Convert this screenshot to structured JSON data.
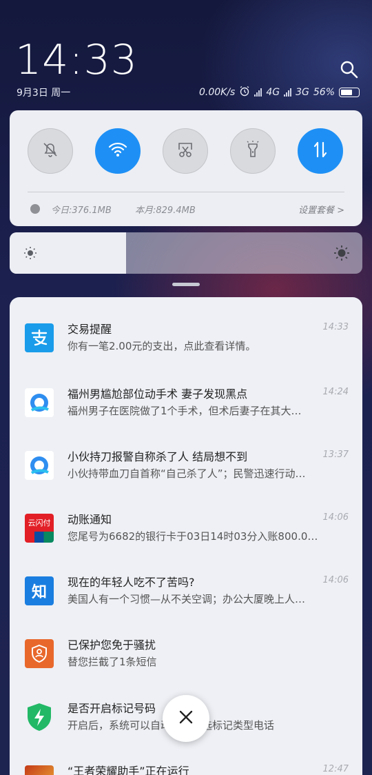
{
  "lockscreen": {
    "time": "14:33",
    "date": "9月3日 周一",
    "net_speed": "0.00K/s",
    "net1": "4G",
    "net2": "3G",
    "battery": "56%"
  },
  "quick_settings": {
    "toggles": [
      {
        "name": "mute",
        "icon": "bell-off-icon",
        "on": false
      },
      {
        "name": "wifi",
        "icon": "wifi-icon",
        "on": true
      },
      {
        "name": "screenshot",
        "icon": "scissors-screenshot-icon",
        "on": false
      },
      {
        "name": "flashlight",
        "icon": "flashlight-icon",
        "on": false
      },
      {
        "name": "mobile-data",
        "icon": "data-arrows-icon",
        "on": true
      }
    ],
    "data_today": "今日:376.1MB",
    "data_month": "本月:829.4MB",
    "plan_link": "设置套餐 >",
    "brightness": 0.33,
    "accent_color": "#1e90f5"
  },
  "notifications": [
    {
      "app": "alipay",
      "icon": "alipay-icon",
      "title": "交易提醒",
      "time": "14:33",
      "body": "你有一笔2.00元的支出，点此查看详情。"
    },
    {
      "app": "qq-browser",
      "icon": "browser-icon",
      "title": "福州男尴尬部位动手术 妻子发现黑点",
      "time": "14:24",
      "body": "福州男子在医院做了1个手术，但术后妻子在其大…"
    },
    {
      "app": "qq-browser",
      "icon": "browser-icon",
      "title": "小伙持刀报警自称杀了人 结局想不到",
      "time": "13:37",
      "body": "小伙持带血刀自首称“自己杀了人”；民警迅速行动…"
    },
    {
      "app": "unionpay",
      "icon": "unionpay-icon",
      "title": "动账通知",
      "time": "14:06",
      "body": "您尾号为6682的银行卡于03日14时03分入账800.0…",
      "icon_text": "云闪付"
    },
    {
      "app": "zhihu",
      "icon": "zhihu-icon",
      "title": "现在的年轻人吃不了苦吗?",
      "time": "14:06",
      "body": "美国人有一个习惯—从不关空调；办公大厦晚上人…",
      "icon_text": "知"
    },
    {
      "app": "security",
      "icon": "shield-user-icon",
      "title": "已保护您免于骚扰",
      "time": "",
      "body": "替您拦截了1条短信"
    },
    {
      "app": "security-center",
      "icon": "shield-bolt-icon",
      "title": "是否开启标记号码",
      "time": "",
      "body": "开启后，系统可以自动挂断所选标记类型电话"
    },
    {
      "app": "game-assistant",
      "icon": "game-icon",
      "title": "“王者荣耀助手”正在运行",
      "time": "12:47",
      "body": ""
    }
  ]
}
